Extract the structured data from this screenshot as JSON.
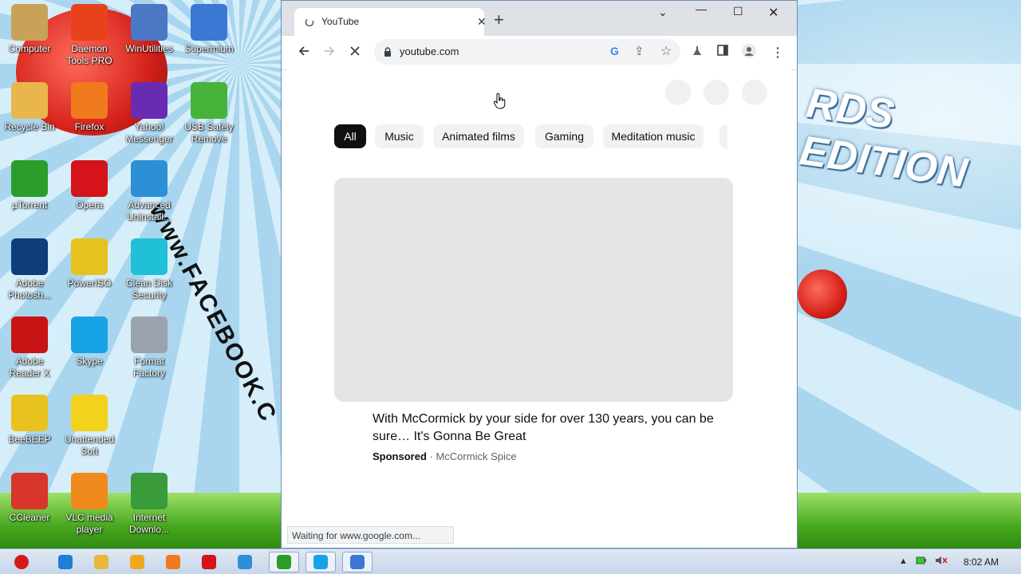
{
  "desktop": {
    "icons": [
      {
        "label": "Computer",
        "icon": "computer-icon",
        "color": "#c9a25a"
      },
      {
        "label": "Daemon Tools PRO",
        "icon": "daemon-tools-icon",
        "color": "#e8421d"
      },
      {
        "label": "WinUtilities",
        "icon": "winutilities-icon",
        "color": "#4a78c4"
      },
      {
        "label": "Supermium",
        "icon": "supermium-icon",
        "color": "#3b78d4"
      },
      {
        "label": "Recycle Bin",
        "icon": "recycle-bin-icon",
        "color": "#e9b64b"
      },
      {
        "label": "Firefox",
        "icon": "firefox-icon",
        "color": "#f07a1e"
      },
      {
        "label": "Yahoo! Messenger",
        "icon": "yahoo-messenger-icon",
        "color": "#6a2bb3"
      },
      {
        "label": "USB Safely Remove",
        "icon": "usb-icon",
        "color": "#45b33a"
      },
      {
        "label": "µTorrent",
        "icon": "utorrent-icon",
        "color": "#2a9d2a"
      },
      {
        "label": "Opera",
        "icon": "opera-icon",
        "color": "#d4141a"
      },
      {
        "label": "Advanced Uninstall...",
        "icon": "advanced-uninstaller-icon",
        "color": "#2d8fd6"
      },
      {
        "label": "Adobe Photosh...",
        "icon": "photoshop-icon",
        "color": "#0f3d7a"
      },
      {
        "label": "PowerISO",
        "icon": "poweriso-icon",
        "color": "#e6c21e"
      },
      {
        "label": "Clean Disk Security",
        "icon": "clean-disk-icon",
        "color": "#1fc0d8"
      },
      {
        "label": "Adobe Reader X",
        "icon": "adobe-reader-icon",
        "color": "#c81414"
      },
      {
        "label": "Skype",
        "icon": "skype-icon",
        "color": "#16a3e6"
      },
      {
        "label": "Format Factory",
        "icon": "format-factory-icon",
        "color": "#9aa3ad"
      },
      {
        "label": "BeeBEEP",
        "icon": "beebeep-icon",
        "color": "#e8c21e"
      },
      {
        "label": "Unattended Soft",
        "icon": "unattended-soft-icon",
        "color": "#f2d21a"
      },
      {
        "label": "CCleaner",
        "icon": "ccleaner-icon",
        "color": "#d8362a"
      },
      {
        "label": "VLC media player",
        "icon": "vlc-icon",
        "color": "#f18a1c"
      },
      {
        "label": "Internet Downlo...",
        "icon": "idm-icon",
        "color": "#3a9b3a"
      }
    ],
    "wallpaper_text": "www.FACEBOOK.C",
    "wallpaper_title": "RDS EDITION"
  },
  "browser": {
    "tab_title": "YouTube",
    "url": "youtube.com",
    "status_text": "Waiting for www.google.com..."
  },
  "youtube": {
    "chips": [
      "All",
      "Music",
      "Animated films",
      "Gaming",
      "Meditation music"
    ],
    "ad": {
      "title": "With McCormick by your side for over 130 years, you can be sure… It's Gonna Be Great",
      "sponsored": "Sponsored",
      "separator": " · ",
      "advertiser": "McCormick Spice"
    }
  },
  "taskbar": {
    "clock": "8:02 AM",
    "apps": [
      "start-orb-icon",
      "ie-icon",
      "explorer-icon",
      "media-player-icon",
      "firefox-icon",
      "opera-icon",
      "advanced-uninstaller-icon",
      "utorrent-icon",
      "skype-icon",
      "supermium-icon"
    ]
  }
}
